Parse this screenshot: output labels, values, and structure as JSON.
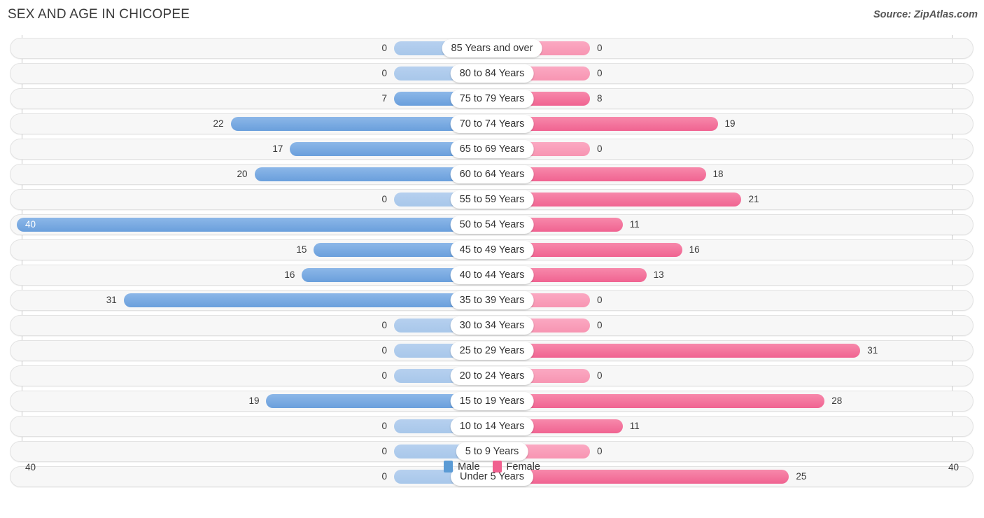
{
  "header": {
    "title": "SEX AND AGE IN CHICOPEE",
    "source": "Source: ZipAtlas.com"
  },
  "legend": {
    "male_label": "Male",
    "female_label": "Female",
    "male_color": "#5b9bd5",
    "female_color": "#f0608f"
  },
  "axis": {
    "left_max_label": "40",
    "right_max_label": "40",
    "max": 40
  },
  "chart_data": {
    "type": "bar",
    "subtype": "population-pyramid",
    "title": "SEX AND AGE IN CHICOPEE",
    "xlabel": "",
    "ylabel": "",
    "xlim": [
      40,
      40
    ],
    "grid": true,
    "legend_position": "bottom-center",
    "categories": [
      "85 Years and over",
      "80 to 84 Years",
      "75 to 79 Years",
      "70 to 74 Years",
      "65 to 69 Years",
      "60 to 64 Years",
      "55 to 59 Years",
      "50 to 54 Years",
      "45 to 49 Years",
      "40 to 44 Years",
      "35 to 39 Years",
      "30 to 34 Years",
      "25 to 29 Years",
      "20 to 24 Years",
      "15 to 19 Years",
      "10 to 14 Years",
      "5 to 9 Years",
      "Under 5 Years"
    ],
    "series": [
      {
        "name": "Male",
        "values": [
          0,
          0,
          7,
          22,
          17,
          20,
          0,
          40,
          15,
          16,
          31,
          0,
          0,
          0,
          19,
          0,
          0,
          0
        ]
      },
      {
        "name": "Female",
        "values": [
          0,
          0,
          8,
          19,
          0,
          18,
          21,
          11,
          16,
          13,
          0,
          0,
          31,
          0,
          28,
          11,
          0,
          25
        ]
      }
    ]
  },
  "rows": [
    {
      "category": "85 Years and over",
      "male": "0",
      "female": "0"
    },
    {
      "category": "80 to 84 Years",
      "male": "0",
      "female": "0"
    },
    {
      "category": "75 to 79 Years",
      "male": "7",
      "female": "8"
    },
    {
      "category": "70 to 74 Years",
      "male": "22",
      "female": "19"
    },
    {
      "category": "65 to 69 Years",
      "male": "17",
      "female": "0"
    },
    {
      "category": "60 to 64 Years",
      "male": "20",
      "female": "18"
    },
    {
      "category": "55 to 59 Years",
      "male": "0",
      "female": "21"
    },
    {
      "category": "50 to 54 Years",
      "male": "40",
      "female": "11"
    },
    {
      "category": "45 to 49 Years",
      "male": "15",
      "female": "16"
    },
    {
      "category": "40 to 44 Years",
      "male": "16",
      "female": "13"
    },
    {
      "category": "35 to 39 Years",
      "male": "31",
      "female": "0"
    },
    {
      "category": "30 to 34 Years",
      "male": "0",
      "female": "0"
    },
    {
      "category": "25 to 29 Years",
      "male": "0",
      "female": "31"
    },
    {
      "category": "20 to 24 Years",
      "male": "0",
      "female": "0"
    },
    {
      "category": "15 to 19 Years",
      "male": "19",
      "female": "28"
    },
    {
      "category": "10 to 14 Years",
      "male": "0",
      "female": "11"
    },
    {
      "category": "5 to 9 Years",
      "male": "0",
      "female": "0"
    },
    {
      "category": "Under 5 Years",
      "male": "0",
      "female": "25"
    }
  ]
}
